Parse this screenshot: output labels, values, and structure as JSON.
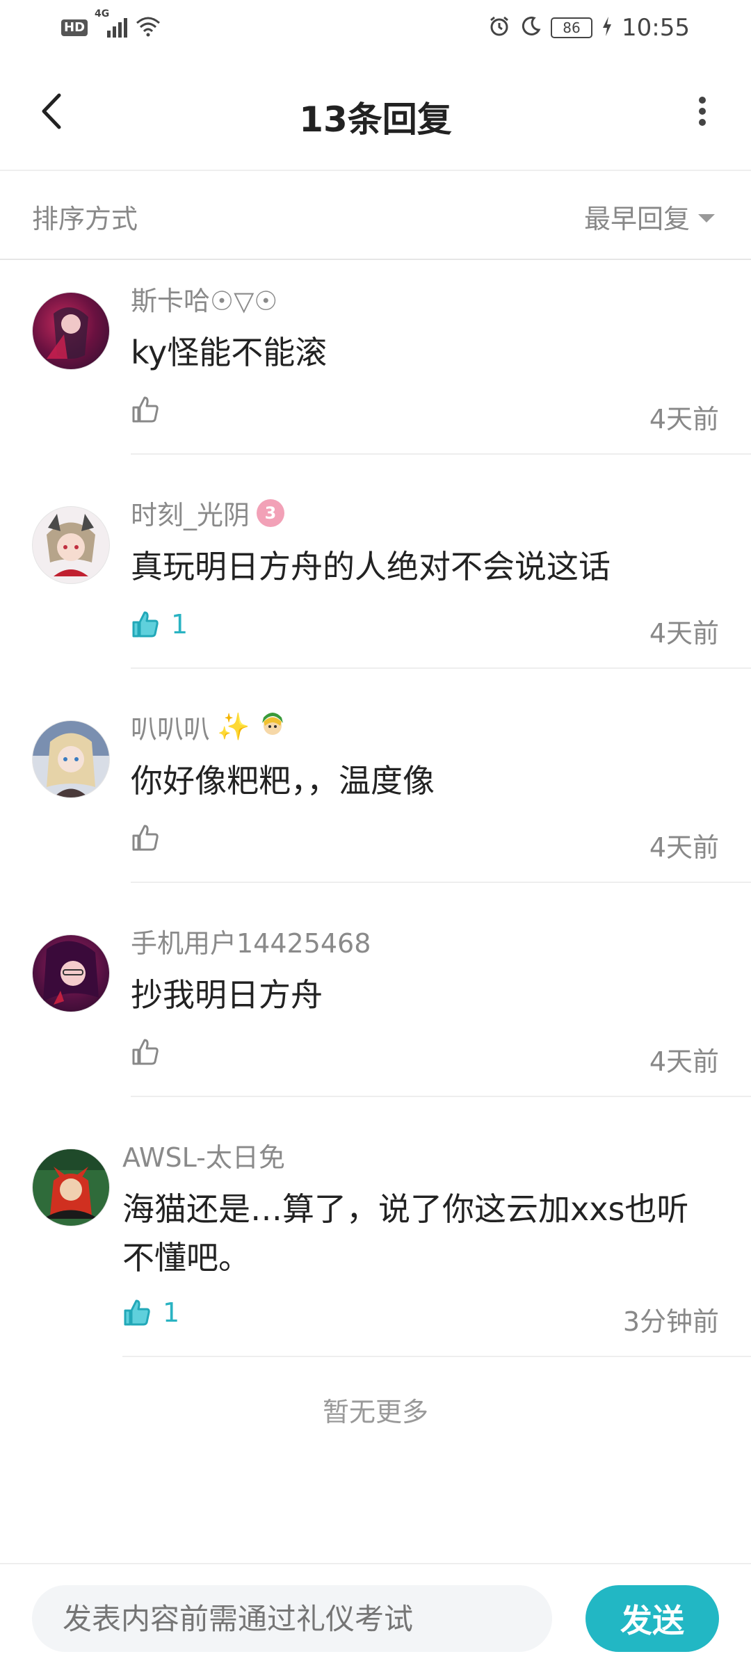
{
  "status_bar": {
    "hd": "HD",
    "network": "4G",
    "battery": "86",
    "time": "10:55"
  },
  "header": {
    "title": "13条回复"
  },
  "sort": {
    "label": "排序方式",
    "selected": "最早回复"
  },
  "comments": [
    {
      "author": "斯卡哈☉▽☉",
      "content": "ky怪能不能滚",
      "likes": "",
      "liked": false,
      "time": "4天前"
    },
    {
      "author": "时刻_光阴",
      "badge": "3",
      "content": "真玩明日方舟的人绝对不会说这话",
      "likes": "1",
      "liked": true,
      "time": "4天前"
    },
    {
      "author": "叭叭叭",
      "author_emoji": "✨",
      "content": "你好像粑粑，，温度像",
      "likes": "",
      "liked": false,
      "time": "4天前"
    },
    {
      "author": "手机用户14425468",
      "content": "抄我明日方舟",
      "likes": "",
      "liked": false,
      "time": "4天前"
    },
    {
      "author": "AWSL-太日免",
      "content_line1": "海猫还是…算了，说了你这云加xxs也听",
      "content_line2": "不懂吧。",
      "likes": "1",
      "liked": true,
      "time": "3分钟前"
    }
  ],
  "no_more": "暂无更多",
  "composer": {
    "placeholder": "发表内容前需通过礼仪考试",
    "send_label": "发送"
  },
  "colors": {
    "accent": "#22b7c4",
    "like_active": "#2ab3c2",
    "muted_text": "#888888"
  }
}
